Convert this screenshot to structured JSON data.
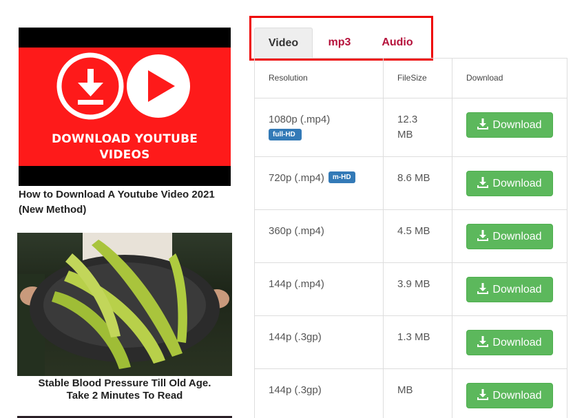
{
  "sidebar": {
    "videos": [
      {
        "thumbnail_text": [
          "DOWNLOAD YOUTUBE",
          "VIDEOS"
        ],
        "title": "How to Download A Youtube Video 2021 (New Method)"
      },
      {
        "title_line1": "Stable Blood Pressure Till Old Age.",
        "title_line2": "Take 2 Minutes To Read"
      }
    ]
  },
  "tabs": [
    {
      "label": "Video",
      "active": true
    },
    {
      "label": "mp3",
      "active": false
    },
    {
      "label": "Audio",
      "active": false
    }
  ],
  "table": {
    "headers": {
      "resolution": "Resolution",
      "filesize": "FileSize",
      "download": "Download"
    },
    "rows": [
      {
        "resolution": "1080p (.mp4)",
        "badge": "full-HD",
        "filesize_line1": "12.3",
        "filesize_line2": "MB",
        "button": "Download"
      },
      {
        "resolution": "720p (.mp4)",
        "badge": "m-HD",
        "filesize": "8.6 MB",
        "button": "Download"
      },
      {
        "resolution": "360p (.mp4)",
        "filesize": "4.5 MB",
        "button": "Download"
      },
      {
        "resolution": "144p (.mp4)",
        "filesize": "3.9 MB",
        "button": "Download"
      },
      {
        "resolution": "144p (.3gp)",
        "filesize": "1.3 MB",
        "button": "Download"
      },
      {
        "resolution": "144p (.3gp)",
        "filesize": "MB",
        "button": "Download"
      }
    ]
  },
  "colors": {
    "tab_accent": "#b5123b",
    "highlight_border": "#ee0000",
    "download_button": "#5cb85c",
    "badge": "#337ab7"
  },
  "icons": {
    "download": "download-icon",
    "play": "play-icon"
  }
}
